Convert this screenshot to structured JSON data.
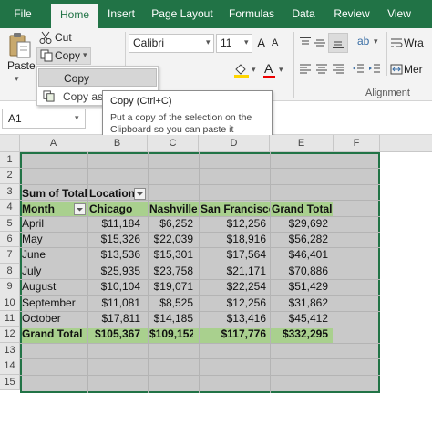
{
  "tabs": [
    "File",
    "Home",
    "Insert",
    "Page Layout",
    "Formulas",
    "Data",
    "Review",
    "View"
  ],
  "ribbon": {
    "paste_label": "Paste",
    "cut_label": "Cut",
    "copy_label": "Copy",
    "font_name": "Calibri",
    "font_size": "11",
    "wrap_label": "Wra",
    "merge_label": "Mer",
    "alignment_group": "Alignment"
  },
  "copy_menu": {
    "items": [
      "Copy",
      "Copy as Pi"
    ]
  },
  "tooltip": {
    "title": "Copy (Ctrl+C)",
    "description": "Put a copy of the selection on the Clipboard so you can paste it somewhere else."
  },
  "name_box": "A1",
  "columns": [
    "A",
    "B",
    "C",
    "D",
    "E",
    "F"
  ],
  "rows": [
    "1",
    "2",
    "3",
    "4",
    "5",
    "6",
    "7",
    "8",
    "9",
    "10",
    "11",
    "12",
    "13",
    "14",
    "15"
  ],
  "pivot": {
    "corner_label": "Sum of Total",
    "location_label": "Location",
    "row_field": "Month",
    "headers": [
      "Chicago",
      "Nashville",
      "San Francisco",
      "Grand Total"
    ],
    "rows": [
      {
        "label": "April",
        "values": [
          "$11,184",
          "$6,252",
          "$12,256",
          "$29,692"
        ]
      },
      {
        "label": "May",
        "values": [
          "$15,326",
          "$22,039",
          "$18,916",
          "$56,282"
        ]
      },
      {
        "label": "June",
        "values": [
          "$13,536",
          "$15,301",
          "$17,564",
          "$46,401"
        ]
      },
      {
        "label": "July",
        "values": [
          "$25,935",
          "$23,758",
          "$21,171",
          "$70,886"
        ]
      },
      {
        "label": "August",
        "values": [
          "$10,104",
          "$19,071",
          "$22,254",
          "$51,429"
        ]
      },
      {
        "label": "September",
        "values": [
          "$11,081",
          "$8,525",
          "$12,256",
          "$31,862"
        ]
      },
      {
        "label": "October",
        "values": [
          "$17,811",
          "$14,185",
          "$13,416",
          "$45,412"
        ]
      }
    ],
    "total": {
      "label": "Grand Total",
      "values": [
        "$105,367",
        "$109,152",
        "$117,776",
        "$332,295"
      ]
    }
  },
  "colors": {
    "excel_green": "#217346",
    "pivot_header_band": "#a9d08e",
    "selection_fill": "#c9c9c9"
  }
}
